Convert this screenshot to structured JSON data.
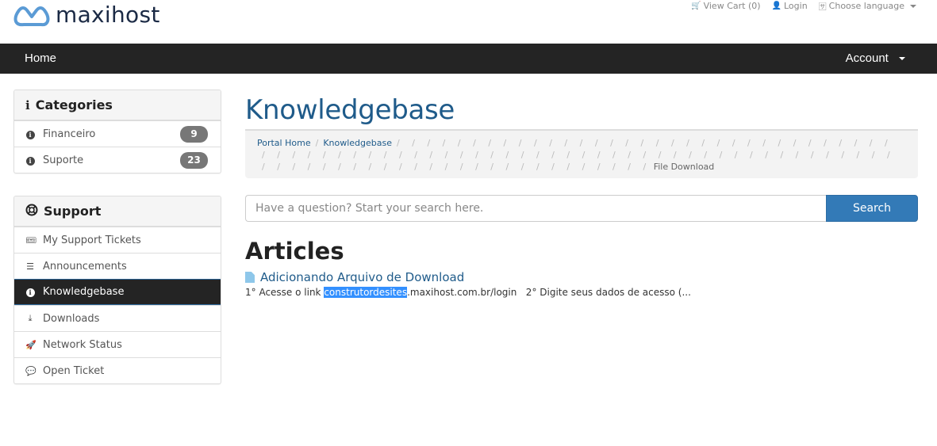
{
  "brand": {
    "name": "maxihost",
    "logo_color": "#5b9bd5"
  },
  "toplinks": {
    "cart": {
      "icon": "cart-icon",
      "label": "View Cart (0)"
    },
    "login": {
      "icon": "user-icon",
      "label": "Login"
    },
    "language": {
      "icon": "language-icon",
      "label": "Choose language"
    }
  },
  "nav": {
    "home": "Home",
    "account": "Account"
  },
  "sidebar": {
    "categories": {
      "title": "Categories",
      "icon": "info-icon",
      "items": [
        {
          "label": "Financeiro",
          "count": "9"
        },
        {
          "label": "Suporte",
          "count": "23"
        }
      ]
    },
    "support": {
      "title": "Support",
      "icon": "lifebuoy-icon",
      "items": [
        {
          "label": "My Support Tickets",
          "icon": "ticket-icon",
          "active": false
        },
        {
          "label": "Announcements",
          "icon": "list-icon",
          "active": false
        },
        {
          "label": "Knowledgebase",
          "icon": "info-circle-icon",
          "active": true
        },
        {
          "label": "Downloads",
          "icon": "download-icon",
          "active": false
        },
        {
          "label": "Network Status",
          "icon": "rocket-icon",
          "active": false
        },
        {
          "label": "Open Ticket",
          "icon": "comments-icon",
          "active": false
        }
      ]
    }
  },
  "main": {
    "title": "Knowledgebase",
    "breadcrumb": {
      "items": [
        "Portal Home",
        "Knowledgebase"
      ],
      "empty_separator_count": 101,
      "current": "File Download"
    },
    "search": {
      "placeholder": "Have a question? Start your search here.",
      "value": "",
      "button": "Search"
    },
    "articles_heading": "Articles",
    "articles": [
      {
        "title": "Adicionando Arquivo de Download",
        "snippet_before": "1° Acesse o link ",
        "snippet_highlight": "construtordesites",
        "snippet_after": ".maxihost.com.br/login   2° Digite seus dados de acesso (..."
      }
    ]
  }
}
